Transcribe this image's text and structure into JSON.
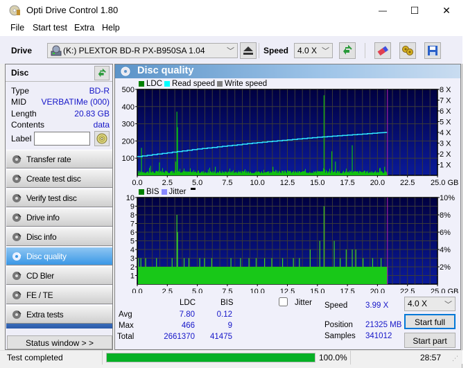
{
  "window": {
    "title": "Opti Drive Control 1.80",
    "controls": {
      "minimize": "—",
      "maximize": "☐",
      "close": "✕"
    }
  },
  "menu": [
    "File",
    "Start test",
    "Extra",
    "Help"
  ],
  "toolbar": {
    "drive_label": "Drive",
    "drive_value": "(K:)   PLEXTOR BD-R  PX-B950SA 1.04",
    "speed_label": "Speed",
    "speed_value": "4.0 X",
    "icons": [
      "eject-icon",
      "refresh-icon",
      "erase-icon",
      "settings-icon",
      "save-icon"
    ]
  },
  "disc": {
    "header": "Disc",
    "rows": [
      {
        "key": "Type",
        "value": "BD-R"
      },
      {
        "key": "MID",
        "value": "VERBATIMe (000)"
      },
      {
        "key": "Length",
        "value": "20.83 GB"
      },
      {
        "key": "Contents",
        "value": "data"
      }
    ],
    "label_key": "Label",
    "label_value": ""
  },
  "nav": [
    {
      "label": "Transfer rate",
      "active": false
    },
    {
      "label": "Create test disc",
      "active": false
    },
    {
      "label": "Verify test disc",
      "active": false
    },
    {
      "label": "Drive info",
      "active": false
    },
    {
      "label": "Disc info",
      "active": false
    },
    {
      "label": "Disc quality",
      "active": true
    },
    {
      "label": "CD Bler",
      "active": false
    },
    {
      "label": "FE / TE",
      "active": false
    },
    {
      "label": "Extra tests",
      "active": false
    }
  ],
  "status_window_button": "Status window > >",
  "panel_title": "Disc quality",
  "chart_data": [
    {
      "type": "bar",
      "title": "LDC",
      "legend": [
        {
          "name": "LDC",
          "color": "#008000"
        },
        {
          "name": "Read speed",
          "color": "#00ffff"
        },
        {
          "name": "Write speed",
          "color": "#808080"
        }
      ],
      "xlabel": "GB",
      "xlim": [
        0,
        25
      ],
      "x_ticks": [
        "0.0",
        "2.5",
        "5.0",
        "7.5",
        "10.0",
        "12.5",
        "15.0",
        "17.5",
        "20.0",
        "22.5",
        "25.0 GB"
      ],
      "ylim_left": [
        0,
        500
      ],
      "y_ticks_left": [
        "500",
        "400",
        "300",
        "200",
        "100"
      ],
      "ylim_right": [
        0,
        8
      ],
      "y_ticks_right": [
        "8 X",
        "7 X",
        "6 X",
        "5 X",
        "4 X",
        "3 X",
        "2 X",
        "1 X"
      ],
      "grid": true,
      "end_marker_gb": 20.83,
      "ldc_baseline": 25,
      "ldc_spikes": [
        {
          "x": 0.35,
          "y": 160
        },
        {
          "x": 1.1,
          "y": 55
        },
        {
          "x": 1.85,
          "y": 75
        },
        {
          "x": 3.2,
          "y": 80
        },
        {
          "x": 3.3,
          "y": 370
        },
        {
          "x": 3.35,
          "y": 280
        },
        {
          "x": 6.5,
          "y": 50
        },
        {
          "x": 11.3,
          "y": 50
        },
        {
          "x": 15.55,
          "y": 466
        },
        {
          "x": 16.2,
          "y": 140
        },
        {
          "x": 16.5,
          "y": 80
        },
        {
          "x": 17.9,
          "y": 175
        },
        {
          "x": 20.6,
          "y": 50
        }
      ],
      "read_speed_series": [
        {
          "x": 0.0,
          "y": 1.75
        },
        {
          "x": 2.5,
          "y": 2.1
        },
        {
          "x": 5.0,
          "y": 2.45
        },
        {
          "x": 7.5,
          "y": 2.75
        },
        {
          "x": 10.0,
          "y": 3.05
        },
        {
          "x": 12.5,
          "y": 3.3
        },
        {
          "x": 15.0,
          "y": 3.55
        },
        {
          "x": 17.5,
          "y": 3.75
        },
        {
          "x": 20.0,
          "y": 3.95
        },
        {
          "x": 20.83,
          "y": 4.0
        }
      ]
    },
    {
      "type": "bar",
      "title": "BIS",
      "legend": [
        {
          "name": "BIS",
          "color": "#008000"
        },
        {
          "name": "Jitter",
          "color": "#8888ff"
        }
      ],
      "xlabel": "GB",
      "xlim": [
        0,
        25
      ],
      "x_ticks": [
        "0.0",
        "2.5",
        "5.0",
        "7.5",
        "10.0",
        "12.5",
        "15.0",
        "17.5",
        "20.0",
        "22.5",
        "25.0 GB"
      ],
      "ylim_left": [
        0,
        10
      ],
      "y_ticks_left": [
        "10",
        "9",
        "8",
        "7",
        "6",
        "5",
        "4",
        "3",
        "2",
        "1"
      ],
      "ylim_right": [
        0,
        10
      ],
      "y_ticks_right": [
        "10%",
        "8%",
        "6%",
        "4%",
        "2%"
      ],
      "grid": true,
      "end_marker_gb": 20.83,
      "bis_baseline": 2,
      "bis_spikes": [
        {
          "x": 0.1,
          "y": 3
        },
        {
          "x": 0.3,
          "y": 3
        },
        {
          "x": 0.7,
          "y": 3
        },
        {
          "x": 1.6,
          "y": 3
        },
        {
          "x": 2.9,
          "y": 3
        },
        {
          "x": 3.3,
          "y": 8
        },
        {
          "x": 3.35,
          "y": 6
        },
        {
          "x": 3.9,
          "y": 3
        },
        {
          "x": 4.3,
          "y": 3
        },
        {
          "x": 5.2,
          "y": 3
        },
        {
          "x": 5.6,
          "y": 3
        },
        {
          "x": 6.2,
          "y": 3
        },
        {
          "x": 7.8,
          "y": 3
        },
        {
          "x": 8.6,
          "y": 3
        },
        {
          "x": 9.3,
          "y": 3
        },
        {
          "x": 9.9,
          "y": 3
        },
        {
          "x": 10.6,
          "y": 3
        },
        {
          "x": 11.2,
          "y": 3
        },
        {
          "x": 12.1,
          "y": 3
        },
        {
          "x": 13.0,
          "y": 3
        },
        {
          "x": 13.5,
          "y": 3
        },
        {
          "x": 14.4,
          "y": 4
        },
        {
          "x": 15.2,
          "y": 5
        },
        {
          "x": 15.55,
          "y": 9
        },
        {
          "x": 16.4,
          "y": 5
        },
        {
          "x": 16.9,
          "y": 3
        },
        {
          "x": 17.4,
          "y": 4
        },
        {
          "x": 17.9,
          "y": 4
        },
        {
          "x": 18.2,
          "y": 4
        },
        {
          "x": 18.8,
          "y": 3
        },
        {
          "x": 19.6,
          "y": 3
        },
        {
          "x": 20.3,
          "y": 3
        }
      ],
      "bis_dips": [
        1.75,
        2.3,
        2.9,
        6.6,
        20.4
      ]
    }
  ],
  "stats": {
    "col_headers": [
      "LDC",
      "BIS"
    ],
    "rows": [
      {
        "label": "Avg",
        "ldc": "7.80",
        "bis": "0.12"
      },
      {
        "label": "Max",
        "ldc": "466",
        "bis": "9"
      },
      {
        "label": "Total",
        "ldc": "2661370",
        "bis": "41475"
      }
    ],
    "jitter_label": "Jitter",
    "jitter_checked": false,
    "speed_label": "Speed",
    "speed_value": "3.99 X",
    "speed_select": "4.0 X",
    "position_label": "Position",
    "position_value": "21325 MB",
    "samples_label": "Samples",
    "samples_value": "341012",
    "start_full": "Start full",
    "start_part": "Start part"
  },
  "statusbar": {
    "text": "Test completed",
    "progress_percent": 100.0,
    "progress_label": "100.0%",
    "time": "28:57"
  }
}
